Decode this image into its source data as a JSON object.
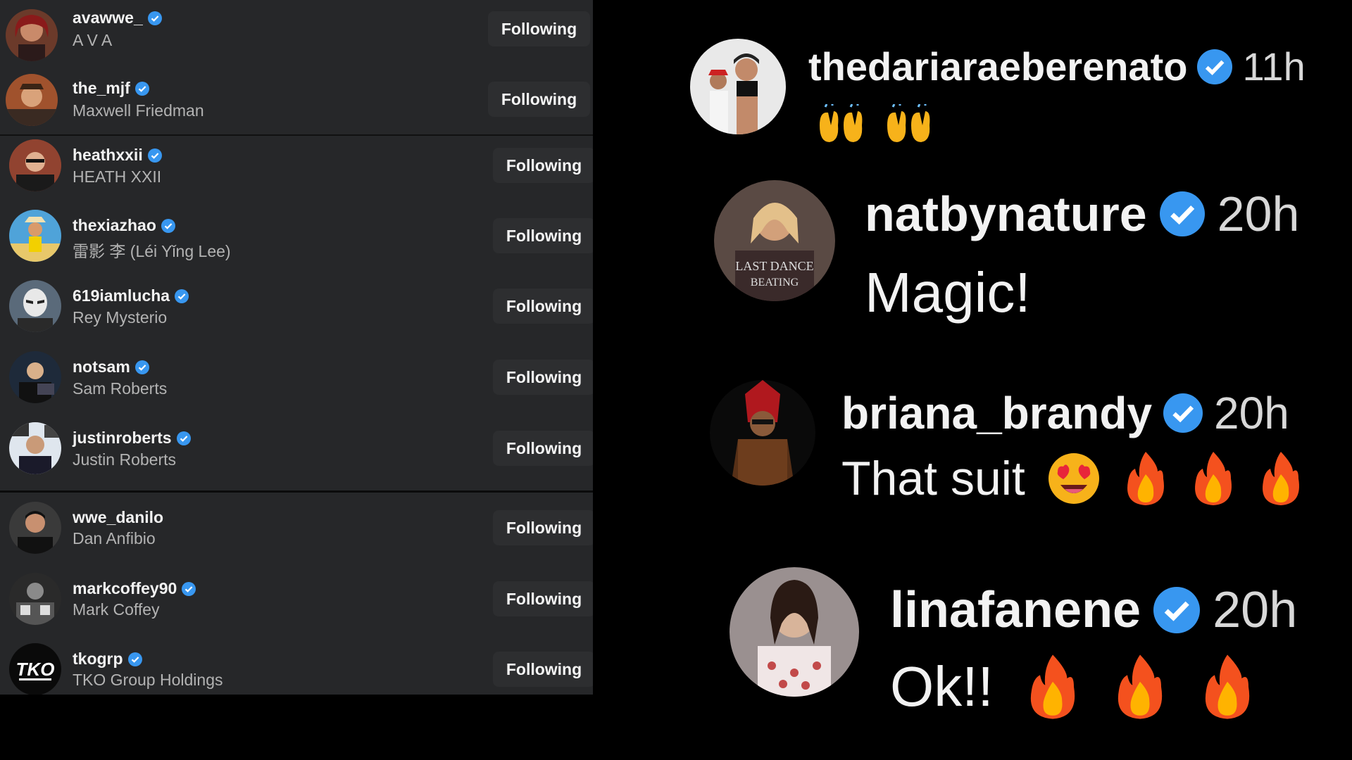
{
  "following_list": {
    "button_label": "Following",
    "accent_color": "#3897f0",
    "items": [
      {
        "username": "avawwe_",
        "display_name": "A V A",
        "verified": true
      },
      {
        "username": "the_mjf",
        "display_name": "Maxwell Friedman",
        "verified": true
      },
      {
        "username": "heathxxii",
        "display_name": "HEATH XXII",
        "verified": true
      },
      {
        "username": "thexiazhao",
        "display_name": "雷影 李 (Léi Yǐng Lee)",
        "verified": true
      },
      {
        "username": "619iamlucha",
        "display_name": "Rey Mysterio",
        "verified": true
      },
      {
        "username": "notsam",
        "display_name": "Sam Roberts",
        "verified": true
      },
      {
        "username": "justinroberts",
        "display_name": "Justin Roberts",
        "verified": true
      },
      {
        "username": "wwe_danilo",
        "display_name": "Dan Anfibio",
        "verified": false
      },
      {
        "username": "markcoffey90",
        "display_name": "Mark Coffey",
        "verified": true
      },
      {
        "username": "tkogrp",
        "display_name": "TKO Group Holdings",
        "verified": true
      }
    ]
  },
  "comments": [
    {
      "username": "thedariaraeberenato",
      "time": "11h",
      "text": "",
      "emojis": [
        "raising-hands",
        "raising-hands"
      ]
    },
    {
      "username": "natbynature",
      "time": "20h",
      "text": "Magic!",
      "emojis": []
    },
    {
      "username": "briana_brandy",
      "time": "20h",
      "text": "That suit",
      "emojis": [
        "heart-eyes",
        "fire",
        "fire",
        "fire"
      ]
    },
    {
      "username": "linafanene",
      "time": "20h",
      "text": "Ok!!",
      "emojis": [
        "fire",
        "fire",
        "fire"
      ]
    }
  ],
  "icons": {
    "verified": "verified-badge-icon",
    "fire": "fire-emoji-icon",
    "heart_eyes": "heart-eyes-emoji-icon",
    "raising_hands": "raising-hands-emoji-icon"
  }
}
